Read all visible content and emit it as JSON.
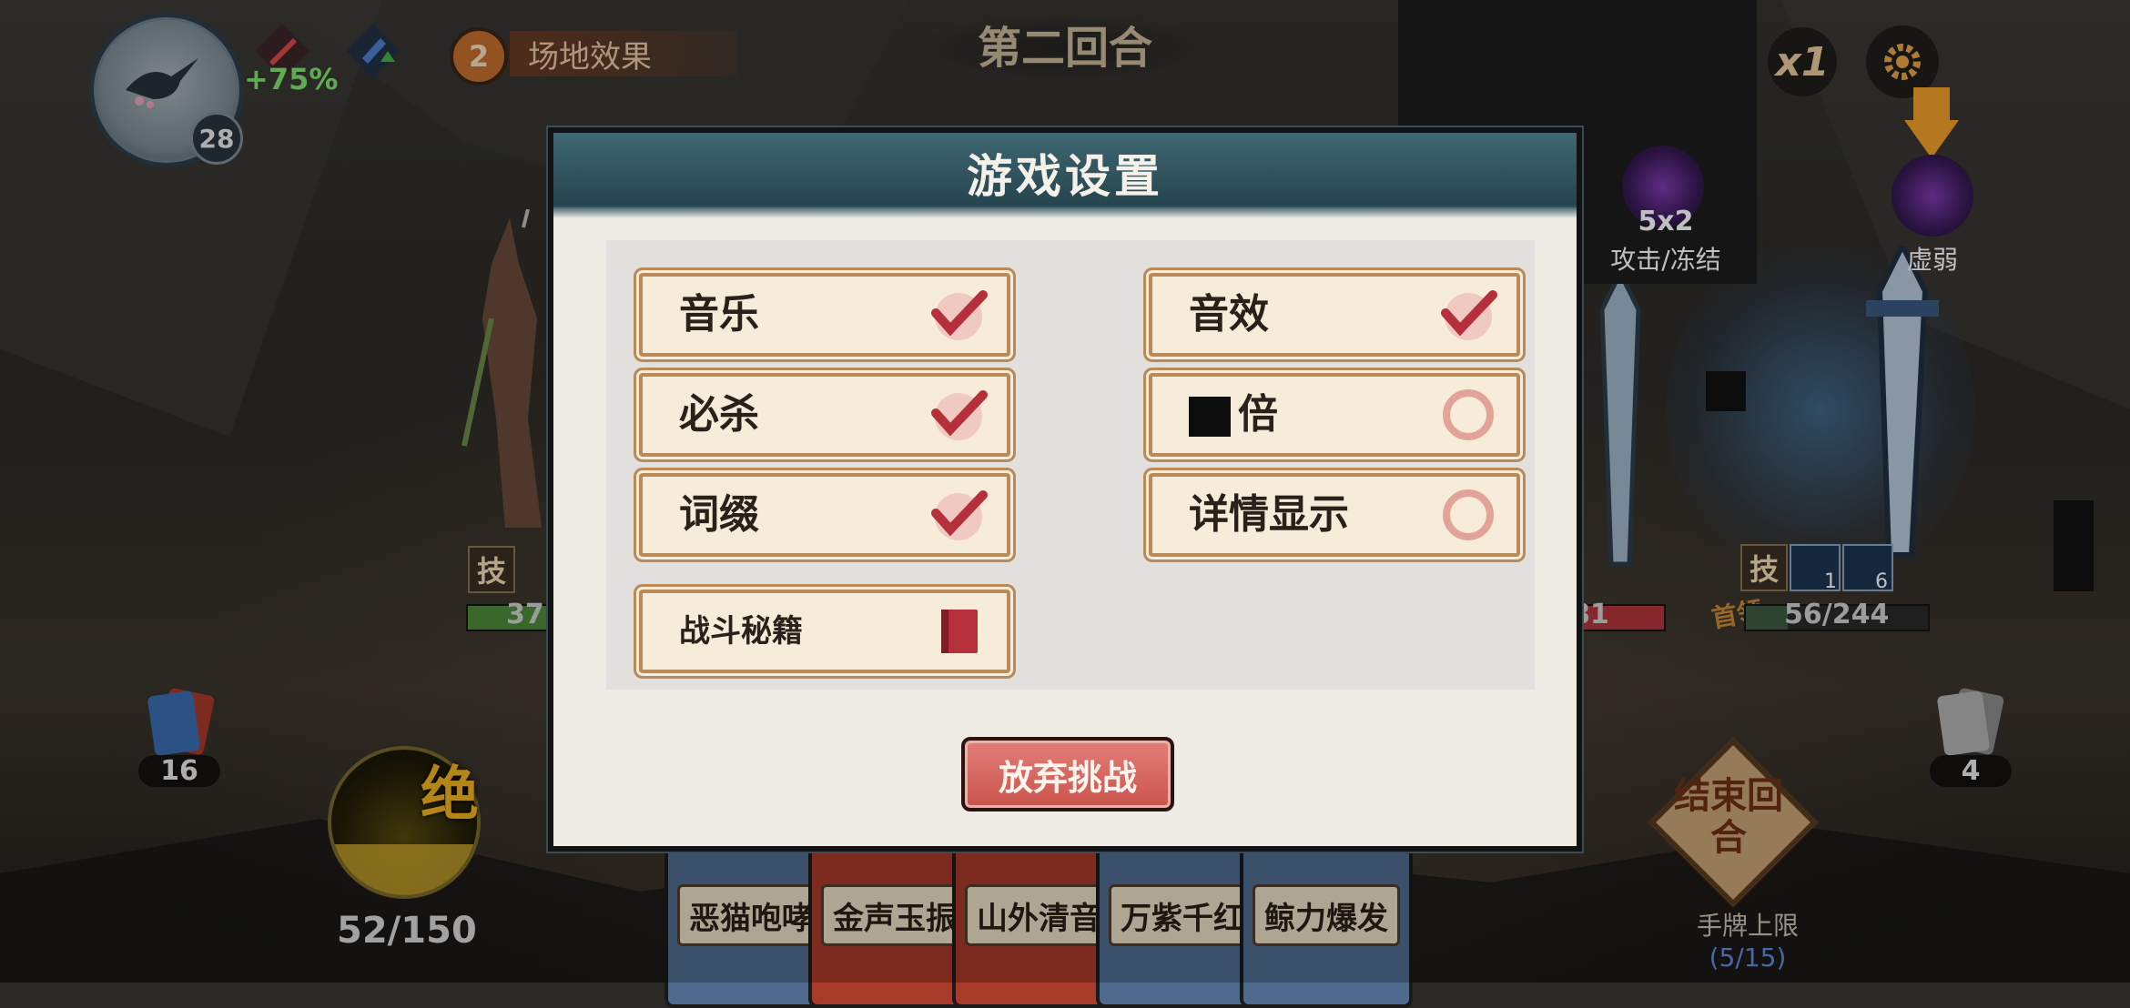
{
  "hud": {
    "player_level": "28",
    "buff_percent": "+75%",
    "field_effect_count": "2",
    "field_effect_label": "场地效果",
    "round_label": "第二回合",
    "speed_label": "x1"
  },
  "enemy": {
    "intent_1_value": "5x2",
    "intent_1_label": "攻击/冻结",
    "intent_2_label": "虚弱",
    "boss_hp": "56/244",
    "boss_tag": "首领",
    "boss_skill_tag": "技",
    "status_1_count": "1",
    "status_2_count": "6",
    "other_hp_fragment": "81"
  },
  "player": {
    "skill_tag": "技",
    "hp_fragment": "37",
    "draw_pile": "16",
    "discard_pile": "4",
    "ult_label": "绝",
    "energy": "52/150",
    "energy_fraction": 0.35
  },
  "end_turn": {
    "label": "结束回合",
    "hand_limit_label": "手牌上限",
    "hand_count": "(5/15)"
  },
  "hand_cards": [
    "恶猫咆哮",
    "金声玉振",
    "山外清音",
    "万紫千红",
    "鲸力爆发"
  ],
  "dialog": {
    "title": "游戏设置",
    "options": {
      "music": {
        "label": "音乐",
        "state": "on"
      },
      "sfx": {
        "label": "音效",
        "state": "on"
      },
      "crit": {
        "label": "必杀",
        "state": "on"
      },
      "speed": {
        "label": "倍",
        "state": "off"
      },
      "affix": {
        "label": "词缀",
        "state": "on"
      },
      "detail": {
        "label": "详情显示",
        "state": "off"
      },
      "guide": {
        "label": "战斗秘籍",
        "state": "book"
      }
    },
    "quit_label": "放弃挑战"
  },
  "colors": {
    "accent_red": "#c9544c",
    "panel_frame": "#b88a5a",
    "dialog_header": "#2f525d",
    "player_hp": "#4e8b3a",
    "enemy_hp": "#b3363a",
    "buff_green": "#7ee46f",
    "gold": "#f0b21f"
  }
}
